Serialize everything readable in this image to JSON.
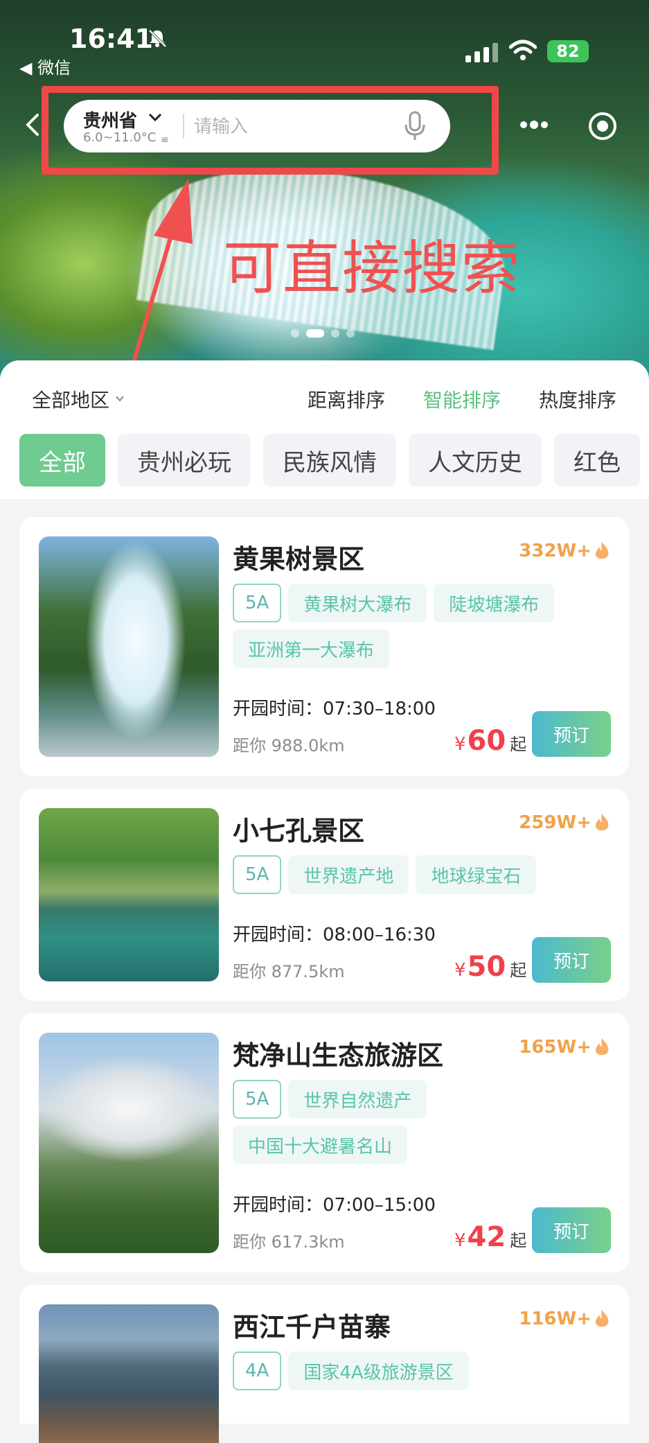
{
  "status_bar": {
    "time": "16:41",
    "back_app": "◀ 微信",
    "battery": "82"
  },
  "search": {
    "city": "贵州省",
    "temperature": "6.0~11.0°C",
    "placeholder": "请输入"
  },
  "annotation": {
    "text": "可直接搜索",
    "color": "#f05050"
  },
  "filter": {
    "region": "全部地区",
    "sorts": [
      "距离排序",
      "智能排序",
      "热度排序"
    ],
    "active_sort": "智能排序",
    "categories": [
      "全部",
      "贵州必玩",
      "民族风情",
      "人文历史",
      "红色"
    ],
    "active_category": "全部"
  },
  "colors": {
    "accent_green": "#6fcb8f",
    "price_red": "#f0404c",
    "hot_orange": "#f0a24a",
    "tag_teal": "#5ac4a6"
  },
  "spots": [
    {
      "name": "黄果树景区",
      "hot": "332W+",
      "level": "5A",
      "tags": [
        "黄果树大瀑布",
        "陡坡塘瀑布",
        "亚洲第一大瀑布"
      ],
      "hours": "开园时间：07:30–18:00",
      "distance": "距你 988.0km",
      "currency": "¥",
      "price": "60",
      "price_suffix": "起",
      "book": "预订"
    },
    {
      "name": "小七孔景区",
      "hot": "259W+",
      "level": "5A",
      "tags": [
        "世界遗产地",
        "地球绿宝石"
      ],
      "hours": "开园时间：08:00–16:30",
      "distance": "距你 877.5km",
      "currency": "¥",
      "price": "50",
      "price_suffix": "起",
      "book": "预订"
    },
    {
      "name": "梵净山生态旅游区",
      "hot": "165W+",
      "level": "5A",
      "tags": [
        "世界自然遗产",
        "中国十大避暑名山"
      ],
      "hours": "开园时间：07:00–15:00",
      "distance": "距你 617.3km",
      "currency": "¥",
      "price": "42",
      "price_suffix": "起",
      "book": "预订"
    },
    {
      "name": "西江千户苗寨",
      "hot": "116W+",
      "level": "4A",
      "tags": [
        "国家4A级旅游景区"
      ]
    }
  ]
}
